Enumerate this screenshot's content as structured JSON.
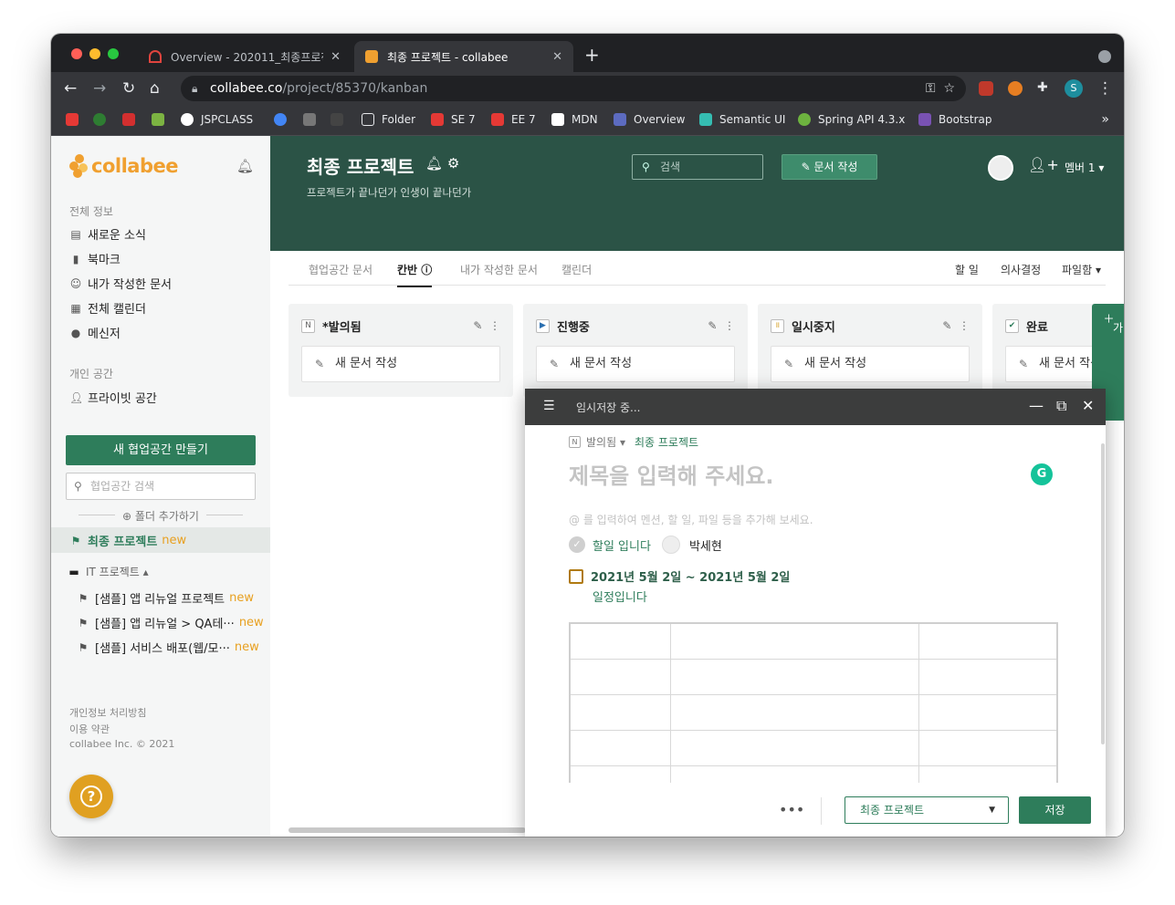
{
  "browser": {
    "tabs": [
      {
        "title": "Overview - 202011_최종프로젝트",
        "active": false
      },
      {
        "title": "최종 프로젝트 - collabee",
        "active": true
      }
    ],
    "new_tab": "+",
    "url_domain": "collabee.co",
    "url_path": "/project/85370/kanban",
    "profile_initial": "S",
    "bookmarks": [
      "JSPCLASS",
      "Folder",
      "SE 7",
      "EE 7",
      "MDN",
      "Overview",
      "Semantic UI",
      "Spring API 4.3.x",
      "Bootstrap"
    ],
    "bookmarks_more": "»"
  },
  "sidebar": {
    "logo": "collabee",
    "section_all": "전체 정보",
    "items": [
      "새로운 소식",
      "북마크",
      "내가 작성한 문서",
      "전체 캘린더",
      "메신저"
    ],
    "section_private": "개인 공간",
    "private_item": "프라이빗 공간",
    "new_workspace_button": "새 협업공간 만들기",
    "workspace_search_placeholder": "협업공간 검색",
    "add_folder": "폴더 추가하기",
    "active_project": "최종 프로젝트",
    "new_label": "new",
    "folder_name": "IT 프로젝트",
    "folder_items": [
      "[샘플] 앱 리뉴얼 프로젝트",
      "[샘플] 앱 리뉴얼 > QA테···",
      "[샘플] 서비스 배포(웹/모···"
    ],
    "footer": [
      "개인정보 처리방침",
      "이용 약관",
      "collabee Inc. © 2021"
    ],
    "help": "?"
  },
  "header": {
    "title": "최종 프로젝트",
    "description": "프로젝트가 끝나던가 인생이 끝나던가",
    "search_placeholder": "검색",
    "write_button": "문서 작성",
    "member_label": "멤버 1"
  },
  "subnav": {
    "tabs": [
      "협업공간 문서",
      "칸반",
      "내가 작성한 문서",
      "캘린더"
    ],
    "active_tab": "칸반",
    "right": [
      "할 일",
      "의사결정",
      "파일함"
    ]
  },
  "kanban": {
    "columns": [
      {
        "name": "*발의됨",
        "icon": "N"
      },
      {
        "name": "진행중",
        "icon": "▶"
      },
      {
        "name": "일시중지",
        "icon": "॥"
      },
      {
        "name": "완료",
        "icon": "✔"
      }
    ],
    "new_doc_label": "새 문서 작성",
    "add_status_tab": "문서상태 추가"
  },
  "editor": {
    "status": "임시저장 중...",
    "breadcrumb_status": "발의됨",
    "breadcrumb_project": "최종 프로젝트",
    "title_placeholder": "제목을 입력해 주세요.",
    "hint": "@ 를 입력하여 멘션, 할 일, 파일 등을 추가해 보세요.",
    "todo_text": "할일 입니다",
    "assignee": "박세현",
    "date_range": "2021년 5월 2일 ~ 2021년 5월 2일",
    "schedule_text": "일정입니다",
    "project_select": "최종 프로젝트",
    "save_button": "저장",
    "more": "•••"
  },
  "colors": {
    "brand_green": "#2e7d5b",
    "header_green": "#2b5346",
    "logo_orange": "#f0a030",
    "new_orange": "#e8a020"
  }
}
